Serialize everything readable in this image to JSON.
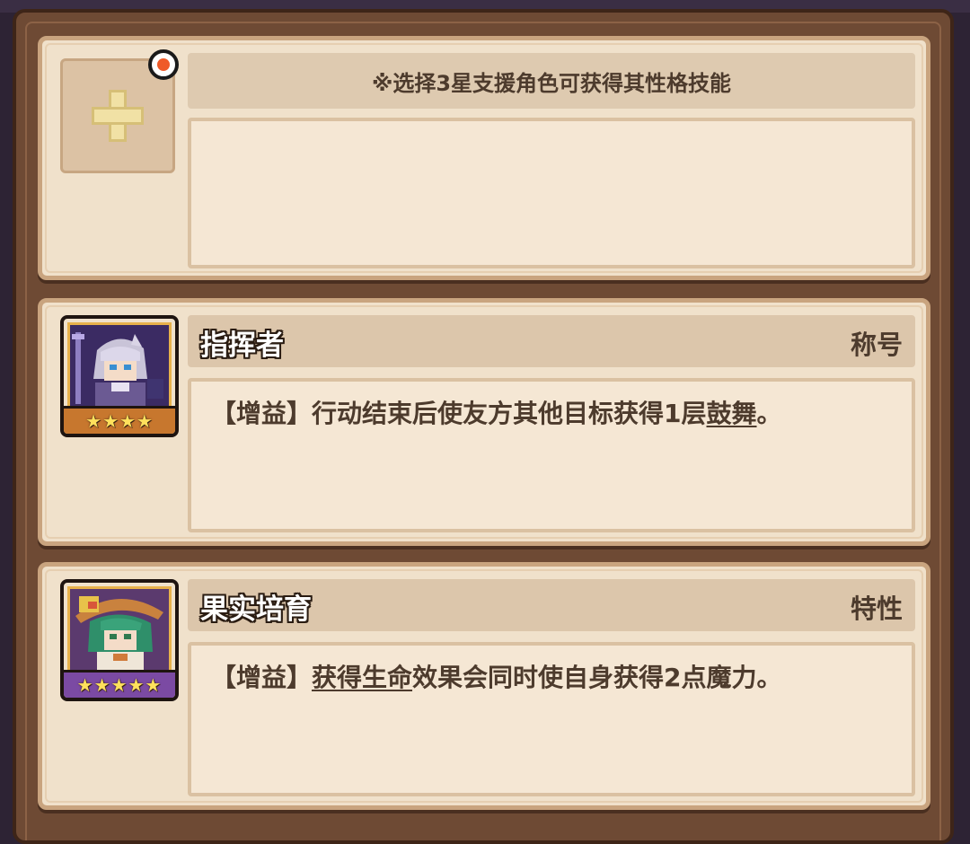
{
  "support_slot": {
    "hint": "※选择3星支援角色可获得其性格技能"
  },
  "skills": [
    {
      "name": "指挥者",
      "tag": "称号",
      "stars": "★★★★",
      "desc_prefix": "【增益】行动结束后使友方其他目标获得1层",
      "keyword": "鼓舞",
      "desc_suffix": "。"
    },
    {
      "name": "果实培育",
      "tag": "特性",
      "stars": "★★★★★",
      "desc_prefix": "【增益】",
      "keyword": "获得生命",
      "desc_suffix": "效果会同时使自身获得2点魔力。"
    }
  ],
  "colors": {
    "panel_bg": "#f0e1cb",
    "frame": "#6e4a34",
    "alert_dot": "#ef5a28",
    "star": "#ffe15c"
  }
}
